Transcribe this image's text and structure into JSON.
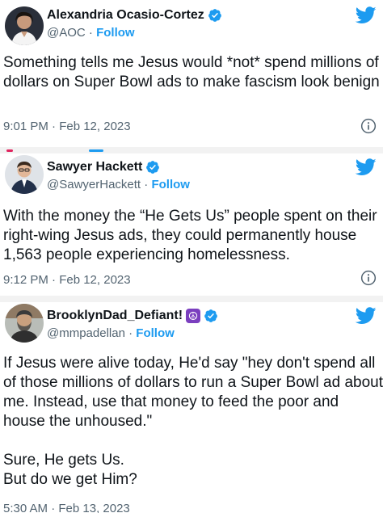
{
  "colors": {
    "brand_blue": "#1d9bf0",
    "text": "#0f1419",
    "secondary_text": "#536471",
    "separator": "#f2f2f2"
  },
  "tweets": [
    {
      "name": "Alexandria Ocasio-Cortez",
      "handle": "@AOC",
      "dot": "·",
      "follow_label": "Follow",
      "verified_icon": "verified-badge-icon",
      "text": "Something tells me Jesus would *not* spend millions of dollars on Super Bowl ads to make fascism look benign",
      "timestamp": "9:01 PM · Feb 12, 2023",
      "avatar_icon": "avatar-aoc",
      "platform_icon": "twitter-bird-icon",
      "info_icon": "info-icon"
    },
    {
      "name": "Sawyer Hackett",
      "handle": "@SawyerHackett",
      "dot": "·",
      "follow_label": "Follow",
      "verified_icon": "verified-badge-icon",
      "text": "With the money the “He Gets Us” people spent on their right-wing Jesus ads, they could permanently house 1,563 people experiencing homelessness.",
      "timestamp": "9:12 PM · Feb 12, 2023",
      "avatar_icon": "avatar-sawyer",
      "platform_icon": "twitter-bird-icon",
      "info_icon": "info-icon"
    },
    {
      "name": "BrooklynDad_Defiant!",
      "name_emoji": "☮",
      "handle": "@mmpadellan",
      "dot": "·",
      "follow_label": "Follow",
      "verified_icon": "verified-badge-icon",
      "text": "If Jesus were alive today, He'd say \"hey don't spend all of those millions of dollars to run a Super Bowl ad about me. Instead, use that money to feed the poor and house the unhoused.\"\n\nSure, He gets Us.\nBut do we get Him?",
      "timestamp": "5:30 AM · Feb 13, 2023",
      "avatar_icon": "avatar-brooklyndad",
      "platform_icon": "twitter-bird-icon"
    }
  ]
}
